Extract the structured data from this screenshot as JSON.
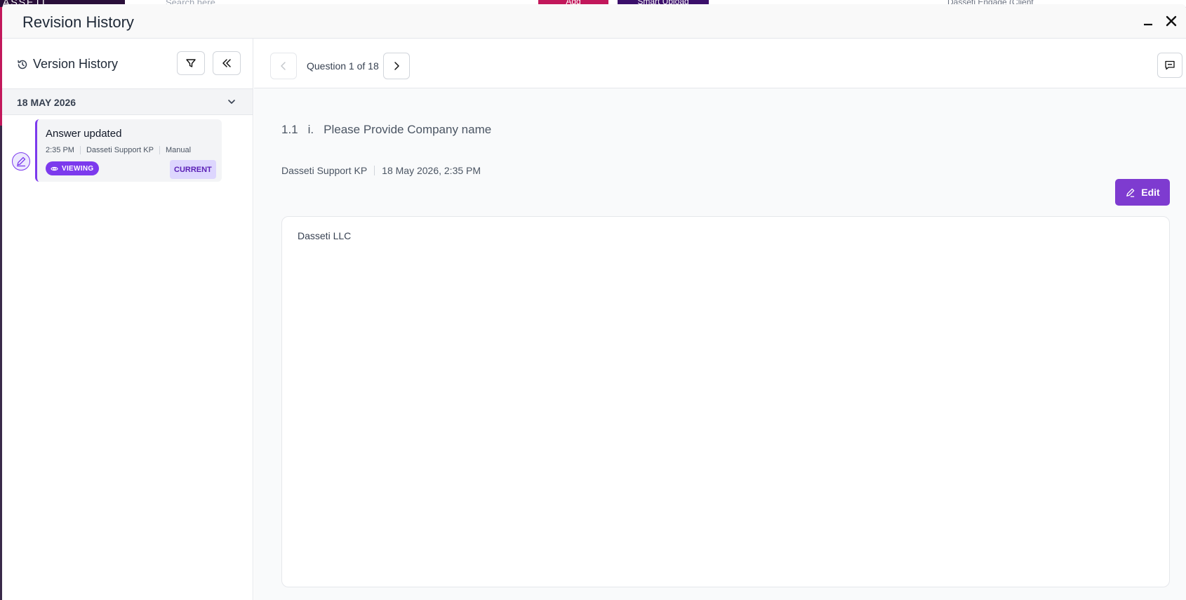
{
  "backdrop": {
    "logo": "ASSETI",
    "search_placeholder": "Search here",
    "add_label": "Add",
    "upload_label": "Smart Upload",
    "client_label": "Dasseti Engage (Client"
  },
  "modal": {
    "title": "Revision History"
  },
  "sidebar": {
    "title": "Version History",
    "date_group": "18 MAY 2026",
    "revisions": [
      {
        "title": "Answer updated",
        "time": "2:35 PM",
        "user": "Dasseti Support KP",
        "source": "Manual",
        "viewing_label": "VIEWING",
        "current_label": "CURRENT"
      }
    ]
  },
  "main": {
    "question_counter": "Question 1 of 18",
    "question_number": "1.1",
    "question_sub": "i.",
    "question_text": "Please Provide Company name",
    "author": "Dasseti Support KP",
    "timestamp": "18 May 2026, 2:35 PM",
    "edit_label": "Edit",
    "answer": "Dasseti LLC"
  },
  "colors": {
    "accent": "#7e3bd0",
    "accent_light": "#ddd6fe",
    "brand_pink": "#c2185b"
  }
}
